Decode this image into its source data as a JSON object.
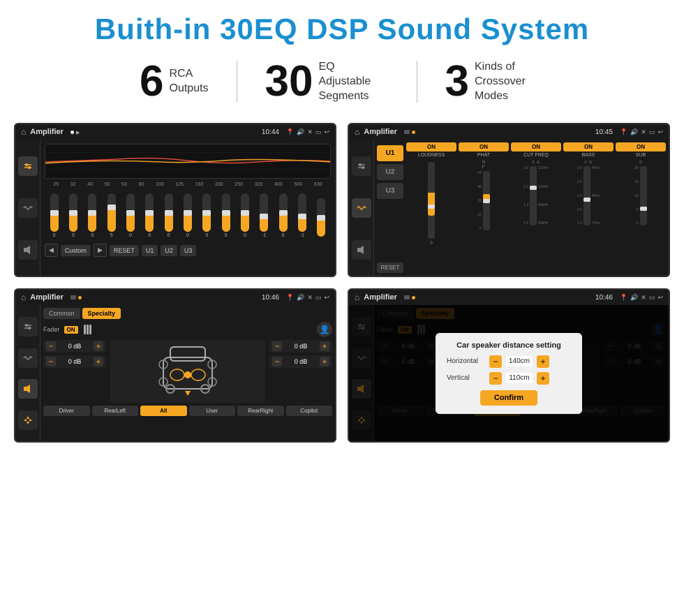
{
  "page": {
    "title": "Buith-in 30EQ DSP Sound System"
  },
  "stats": [
    {
      "number": "6",
      "label": "RCA\nOutputs"
    },
    {
      "number": "30",
      "label": "EQ Adjustable\nSegments"
    },
    {
      "number": "3",
      "label": "Kinds of\nCrossover Modes"
    }
  ],
  "screens": [
    {
      "id": "eq-screen",
      "app_name": "Amplifier",
      "time": "10:44",
      "eq_freqs": [
        "25",
        "32",
        "40",
        "50",
        "63",
        "80",
        "100",
        "125",
        "160",
        "200",
        "250",
        "320",
        "400",
        "500",
        "630"
      ],
      "eq_values": [
        "0",
        "0",
        "0",
        "5",
        "0",
        "0",
        "0",
        "0",
        "0",
        "0",
        "0",
        "-1",
        "0",
        "-1",
        ""
      ],
      "bottom_btns": [
        "◀",
        "Custom",
        "▶",
        "RESET",
        "U1",
        "U2",
        "U3"
      ]
    },
    {
      "id": "crossover-screen",
      "app_name": "Amplifier",
      "time": "10:45",
      "u_buttons": [
        "U1",
        "U2",
        "U3"
      ],
      "channels": [
        {
          "label": "LOUDNESS",
          "on": true
        },
        {
          "label": "PHAT",
          "on": true
        },
        {
          "label": "CUT FREQ",
          "on": true
        },
        {
          "label": "BASS",
          "on": true
        },
        {
          "label": "SUB",
          "on": true
        }
      ],
      "reset_label": "RESET"
    },
    {
      "id": "fader-screen",
      "app_name": "Amplifier",
      "time": "10:46",
      "tabs": [
        "Common",
        "Specialty"
      ],
      "fader_label": "Fader",
      "on_label": "ON",
      "db_values": [
        "0 dB",
        "0 dB",
        "0 dB",
        "0 dB"
      ],
      "bottom_btns": [
        "Driver",
        "RearLeft",
        "All",
        "User",
        "RearRight",
        "Copilot"
      ]
    },
    {
      "id": "dialog-screen",
      "app_name": "Amplifier",
      "time": "10:46",
      "tabs": [
        "Common",
        "Specialty"
      ],
      "fader_label": "Fader",
      "on_label": "ON",
      "dialog": {
        "title": "Car speaker distance setting",
        "horizontal_label": "Horizontal",
        "horizontal_val": "140cm",
        "vertical_label": "Vertical",
        "vertical_val": "110cm",
        "confirm_label": "Confirm"
      },
      "db_values": [
        "0 dB",
        "0 dB"
      ],
      "bottom_btns": [
        "Driver",
        "RearLeft",
        "All",
        "User",
        "RearRight",
        "Copilot"
      ]
    }
  ],
  "colors": {
    "accent": "#f5a623",
    "bg_dark": "#111111",
    "text_light": "#ffffff",
    "blue_title": "#1a8fd1"
  }
}
